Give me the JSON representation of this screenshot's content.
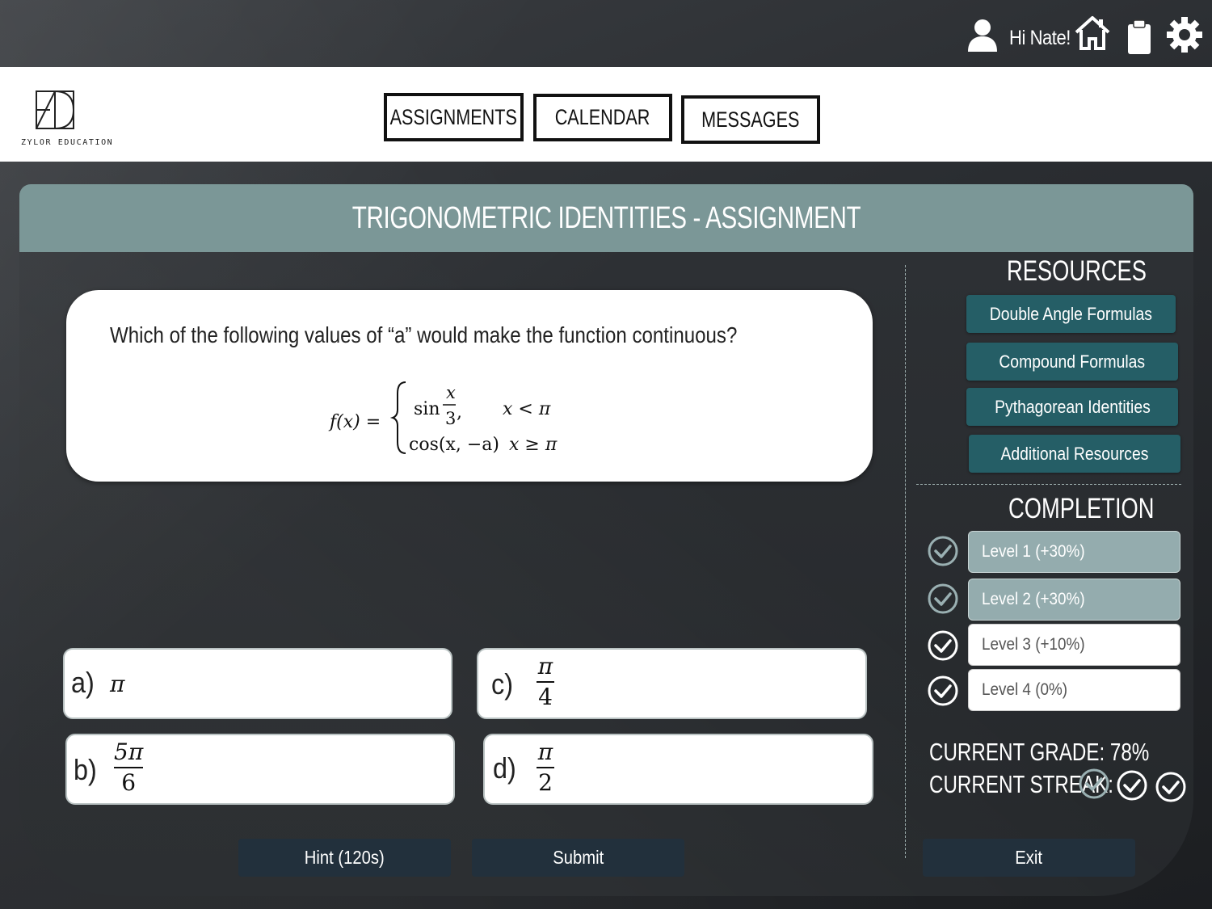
{
  "topbar": {
    "greeting": "Hi Nate!",
    "icons": [
      "user-icon",
      "home-icon",
      "clipboard-icon",
      "gear-icon"
    ]
  },
  "brand": {
    "name": "ZYLOR EDUCATION"
  },
  "nav": {
    "assignments": "ASSIGNMENTS",
    "calendar": "CALENDAR",
    "messages": "MESSAGES"
  },
  "assignment": {
    "title": "TRIGONOMETRIC IDENTITIES - ASSIGNMENT",
    "question": "Which of the following values of “a” would make the function continuous?",
    "formula": {
      "lhs": "f(x) =",
      "case1_expr": "sin",
      "case1_num": "x",
      "case1_den": "3",
      "case1_cond": "x < π",
      "case2_expr": "cos(x, −a)",
      "case2_cond": "x ≥ π"
    },
    "options": {
      "a": {
        "letter": "a)",
        "value": "π"
      },
      "b": {
        "letter": "b)",
        "num": "5π",
        "den": "6"
      },
      "c": {
        "letter": "c)",
        "num": "π",
        "den": "4"
      },
      "d": {
        "letter": "d)",
        "num": "π",
        "den": "2"
      }
    },
    "hint_label": "Hint (120s)",
    "submit_label": "Submit"
  },
  "resources": {
    "heading": "RESOURCES",
    "items": [
      "Double Angle Formulas",
      "Compound Formulas",
      "Pythagorean  Identities",
      "Additional Resources"
    ]
  },
  "completion": {
    "heading": "COMPLETION",
    "levels": [
      {
        "label": "Level 1 (+30%)",
        "state": "done"
      },
      {
        "label": "Level 2 (+30%)",
        "state": "done"
      },
      {
        "label": "Level 3 (+10%)",
        "state": "todo"
      },
      {
        "label": "Level 4 (0%)",
        "state": "todo"
      }
    ]
  },
  "stats": {
    "grade": "CURRENT GRADE: 78%",
    "streak": "CURRENT STREAK:",
    "streak_count": 3
  },
  "exit_label": "Exit",
  "colors": {
    "header_bar": "#7b9797",
    "resource_button": "#255e66",
    "dark_button": "#22303c",
    "level_done": "#94acae"
  }
}
